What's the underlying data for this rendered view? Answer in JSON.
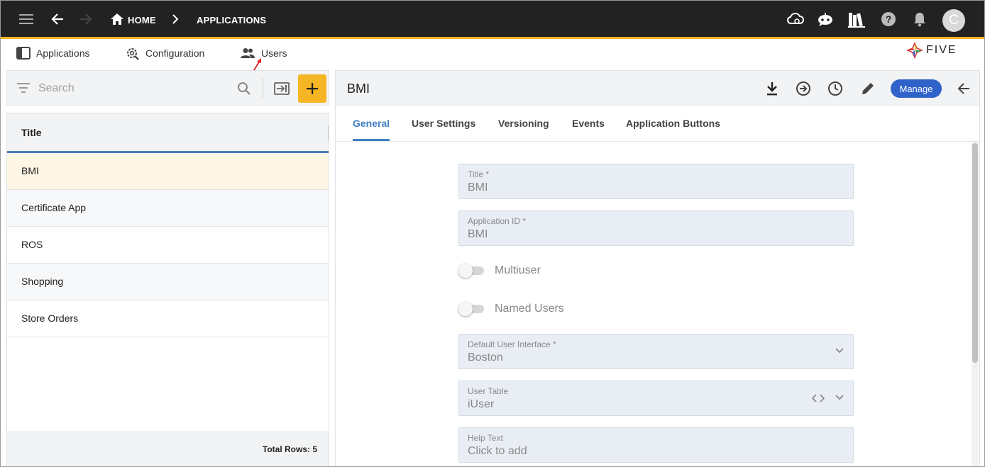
{
  "topbar": {
    "breadcrumb": {
      "home": "HOME",
      "applications": "APPLICATIONS"
    },
    "avatar_initial": "C",
    "icons": [
      "menu-icon",
      "back-arrow-icon",
      "forward-arrow-icon",
      "home-icon",
      "chevron-right-icon",
      "cloud-gear-icon",
      "chat-bot-icon",
      "library-icon",
      "help-icon",
      "bell-icon"
    ],
    "accent": "#f3b51f"
  },
  "menu": {
    "items": [
      {
        "label": "Applications",
        "icon": "panel-icon"
      },
      {
        "label": "Configuration",
        "icon": "gear-wrench-icon"
      },
      {
        "label": "Users",
        "icon": "users-icon"
      }
    ],
    "logo_text": "FIVE"
  },
  "search": {
    "placeholder": "Search"
  },
  "list": {
    "header": "Title",
    "rows": [
      "BMI",
      "Certificate App",
      "ROS",
      "Shopping",
      "Store Orders"
    ],
    "footer": "Total Rows: 5"
  },
  "detail": {
    "title": "BMI",
    "manage_label": "Manage",
    "tabs": [
      "General",
      "User Settings",
      "Versioning",
      "Events",
      "Application Buttons"
    ],
    "fields": {
      "title": {
        "label": "Title *",
        "value": "BMI"
      },
      "app_id": {
        "label": "Application ID *",
        "value": "BMI"
      },
      "multiuser": {
        "label": "Multiuser"
      },
      "named_users": {
        "label": "Named Users"
      },
      "default_ui": {
        "label": "Default User Interface *",
        "value": "Boston"
      },
      "user_table": {
        "label": "User Table",
        "value": "iUser"
      },
      "help_text": {
        "label": "Help Text",
        "value": "Click to add"
      }
    }
  },
  "colors": {
    "add_button": "#f6b524",
    "manage_button": "#2f63c9",
    "tab_active": "#3f7fc4",
    "selected_row": "#fff6e5"
  }
}
